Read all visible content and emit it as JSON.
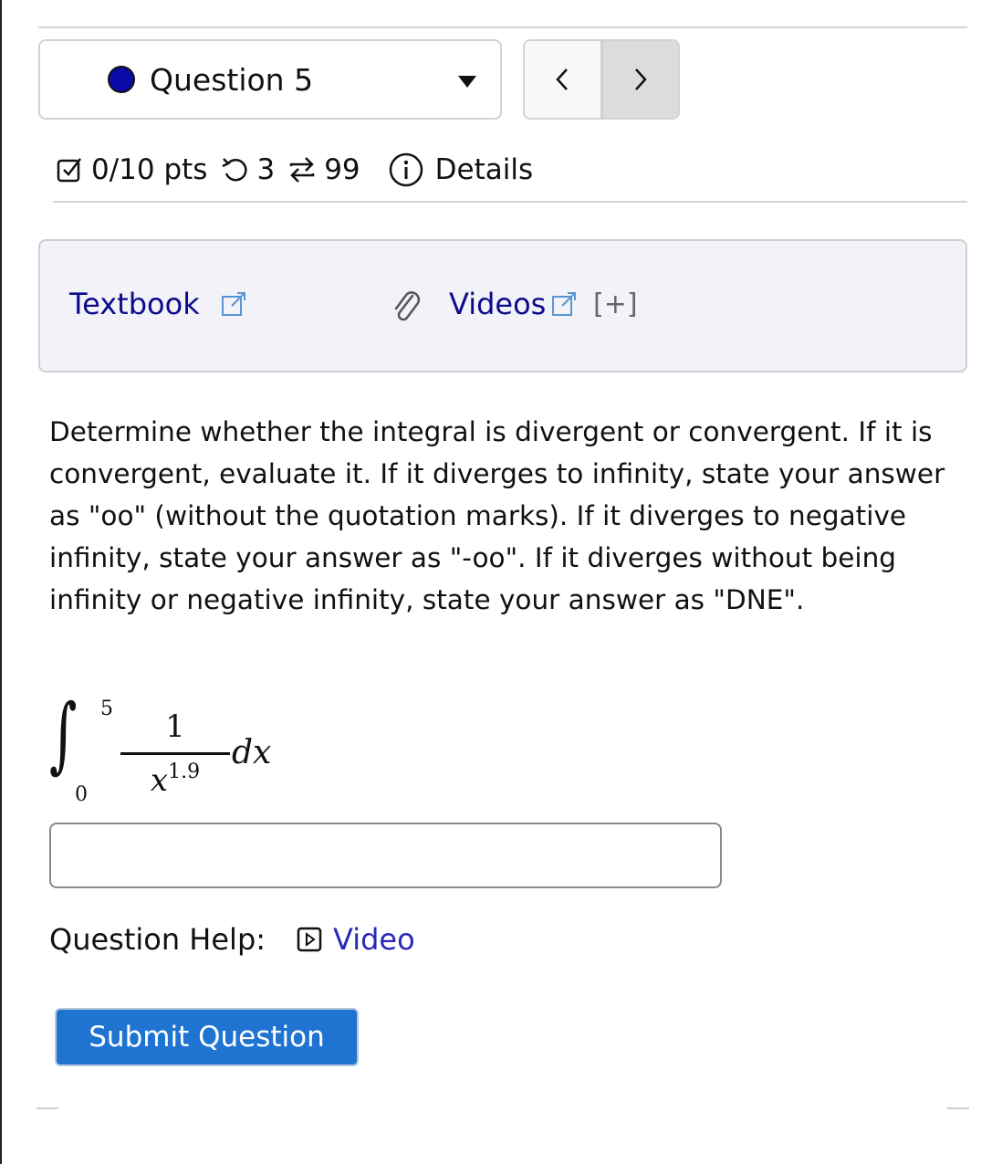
{
  "header": {
    "question_select": {
      "label": "Question 5",
      "status_color": "#0a0aa8"
    },
    "nav": {
      "prev_label": "<",
      "next_label": ">"
    }
  },
  "meta": {
    "score": "0/10 pts",
    "retries": "3",
    "attempts": "99",
    "details_label": "Details"
  },
  "resources": {
    "textbook_label": "Textbook",
    "videos_label": "Videos",
    "expand_label": "[+]"
  },
  "question": {
    "text": "Determine whether the integral is divergent or convergent. If it is convergent, evaluate it. If it diverges to infinity, state your answer as \"oo\" (without the quotation marks). If it diverges to negative infinity, state your answer as \"-oo\". If it diverges without being infinity or negative infinity, state your answer as \"DNE\".",
    "integral": {
      "lower": "0",
      "upper": "5",
      "numerator": "1",
      "base": "x",
      "exponent": "1.9",
      "differential": "dx"
    }
  },
  "answer": {
    "value": "",
    "placeholder": ""
  },
  "help": {
    "label": "Question Help:",
    "video_label": "Video"
  },
  "submit": {
    "label": "Submit Question"
  }
}
